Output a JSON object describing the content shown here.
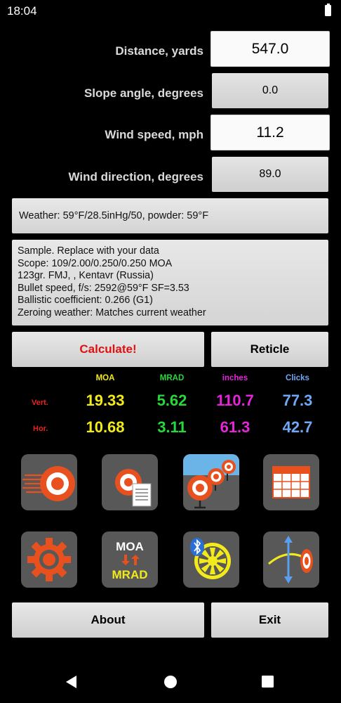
{
  "status_bar": {
    "time": "18:04"
  },
  "inputs": {
    "distance": {
      "label": "Distance, yards",
      "value": "547.0"
    },
    "slope": {
      "label": "Slope angle, degrees",
      "value": "0.0"
    },
    "wind_speed": {
      "label": "Wind speed, mph",
      "value": "11.2"
    },
    "wind_direction": {
      "label": "Wind direction, degrees",
      "value": "89.0"
    }
  },
  "weather": "Weather: 59°F/28.5inHg/50, powder: 59°F",
  "description": [
    "Sample. Replace with your data",
    "Scope: 109/2.00/0.250/0.250 MOA",
    "123gr. FMJ, , Kentavr (Russia)",
    "Bullet speed, f/s: 2592@59°F SF=3.53",
    "Ballistic coefficient: 0.266 (G1)",
    "Zeroing weather: Matches current weather"
  ],
  "buttons": {
    "calculate": "Calculate!",
    "reticle": "Reticle",
    "about": "About",
    "exit": "Exit"
  },
  "results": {
    "headers": [
      "MOA",
      "MRAD",
      "inches",
      "Clicks"
    ],
    "rows": [
      {
        "label": "Vert.",
        "values": [
          "19.33",
          "5.62",
          "110.7",
          "77.3"
        ]
      },
      {
        "label": "Hor.",
        "values": [
          "10.68",
          "3.11",
          "61.3",
          "42.7"
        ]
      }
    ]
  },
  "icons": {
    "moa_mrad_top": "MOA",
    "moa_mrad_bottom": "MRAD"
  },
  "colors": {
    "moa": "#f2ea1b",
    "mrad": "#27d83a",
    "inches": "#e326d8",
    "clicks": "#6fa8f5",
    "calculate": "#e01010",
    "row_label": "#e8231e",
    "tile": "#585858"
  }
}
